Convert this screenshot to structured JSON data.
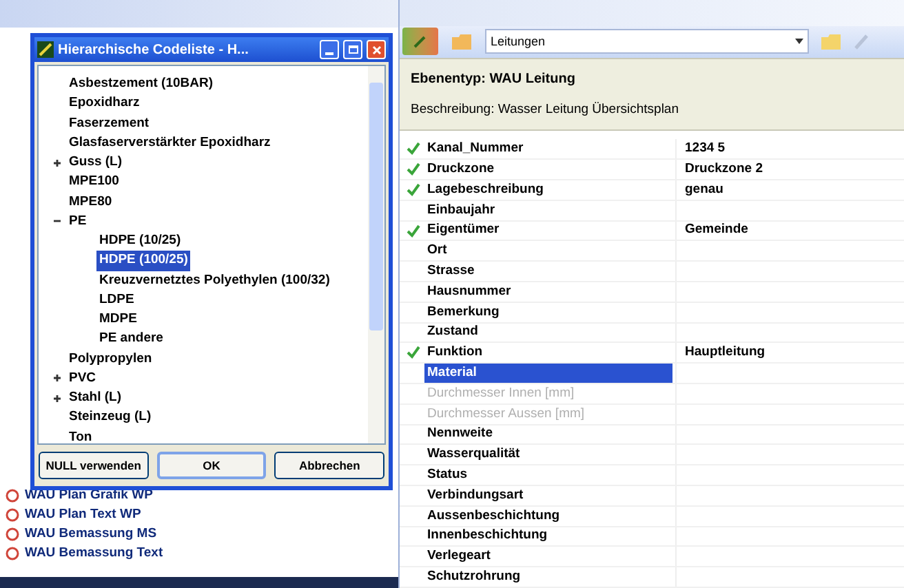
{
  "dialog": {
    "title": "Hierarchische Codeliste - H...",
    "tree": [
      {
        "label": "Asbestzement (10BAR)",
        "kind": "leaf",
        "selected": false
      },
      {
        "label": "Epoxidharz",
        "kind": "leaf",
        "selected": false
      },
      {
        "label": "Faserzement",
        "kind": "leaf",
        "selected": false
      },
      {
        "label": "Glasfaserverstärkter Epoxidharz",
        "kind": "leaf",
        "selected": false
      },
      {
        "label": "Guss (L)",
        "kind": "folder",
        "expanded": false,
        "selected": false
      },
      {
        "label": "MPE100",
        "kind": "leaf",
        "selected": false
      },
      {
        "label": "MPE80",
        "kind": "leaf",
        "selected": false
      },
      {
        "label": "PE",
        "kind": "folder",
        "expanded": true,
        "selected": false,
        "children": [
          {
            "label": "HDPE (10/25)",
            "kind": "leaf",
            "selected": false
          },
          {
            "label": "HDPE (100/25)",
            "kind": "leaf",
            "selected": true
          },
          {
            "label": "Kreuzvernetztes Polyethylen (100/32)",
            "kind": "leaf",
            "selected": false
          },
          {
            "label": "LDPE",
            "kind": "leaf",
            "selected": false
          },
          {
            "label": "MDPE",
            "kind": "leaf",
            "selected": false
          },
          {
            "label": "PE andere",
            "kind": "leaf",
            "selected": false
          }
        ]
      },
      {
        "label": "Polypropylen",
        "kind": "leaf",
        "selected": false
      },
      {
        "label": "PVC",
        "kind": "folder",
        "expanded": false,
        "selected": false
      },
      {
        "label": "Stahl (L)",
        "kind": "folder",
        "expanded": false,
        "selected": false
      },
      {
        "label": "Steinzeug (L)",
        "kind": "leaf",
        "selected": false
      },
      {
        "label": "Ton",
        "kind": "leaf",
        "selected": false
      }
    ],
    "buttons": [
      {
        "label": "NULL verwenden",
        "default": false
      },
      {
        "label": "OK",
        "default": true
      },
      {
        "label": "Abbrechen",
        "default": false
      }
    ]
  },
  "background_list": {
    "items": [
      "WAU Plan Grafik WP",
      "WAU Plan Text WP",
      "WAU Bemassung MS",
      "WAU Bemassung Text"
    ]
  },
  "toolbar": {
    "layer_dropdown": "Leitungen"
  },
  "layer_header": {
    "type": "Ebenentyp: WAU Leitung",
    "description": "Beschreibung: Wasser Leitung Übersichtsplan"
  },
  "properties": [
    {
      "name": "Kanal_Nummer",
      "value": "1234 5",
      "checked": true,
      "selected": false,
      "disabled": false
    },
    {
      "name": "Druckzone",
      "value": "Druckzone 2",
      "checked": true,
      "selected": false,
      "disabled": false
    },
    {
      "name": "Lagebeschreibung",
      "value": "genau",
      "checked": true,
      "selected": false,
      "disabled": false
    },
    {
      "name": "Einbaujahr",
      "checked": false,
      "selected": false,
      "disabled": false
    },
    {
      "name": "Eigentümer",
      "value": "Gemeinde",
      "checked": true,
      "selected": false,
      "disabled": false
    },
    {
      "name": "Ort",
      "checked": false,
      "selected": false,
      "disabled": false
    },
    {
      "name": "Strasse",
      "checked": false,
      "selected": false,
      "disabled": false
    },
    {
      "name": "Hausnummer",
      "checked": false,
      "selected": false,
      "disabled": false
    },
    {
      "name": "Bemerkung",
      "checked": false,
      "selected": false,
      "disabled": false
    },
    {
      "name": "Zustand",
      "checked": false,
      "selected": false,
      "disabled": false
    },
    {
      "name": "Funktion",
      "value": "Hauptleitung",
      "checked": true,
      "selected": false,
      "disabled": false
    },
    {
      "name": "Material",
      "checked": false,
      "selected": true,
      "disabled": false
    },
    {
      "name": "Durchmesser Innen [mm]",
      "checked": false,
      "selected": false,
      "disabled": true
    },
    {
      "name": "Durchmesser Aussen [mm]",
      "checked": false,
      "selected": false,
      "disabled": true
    },
    {
      "name": "Nennweite",
      "checked": false,
      "selected": false,
      "disabled": false
    },
    {
      "name": "Wasserqualität",
      "checked": false,
      "selected": false,
      "disabled": false
    },
    {
      "name": "Status",
      "checked": false,
      "selected": false,
      "disabled": false
    },
    {
      "name": "Verbindungsart",
      "checked": false,
      "selected": false,
      "disabled": false
    },
    {
      "name": "Aussenbeschichtung",
      "checked": false,
      "selected": false,
      "disabled": false
    },
    {
      "name": "Innenbeschichtung",
      "checked": false,
      "selected": false,
      "disabled": false
    },
    {
      "name": "Verlegeart",
      "checked": false,
      "selected": false,
      "disabled": false
    },
    {
      "name": "Schutzrohrung",
      "checked": false,
      "selected": false,
      "disabled": false
    }
  ]
}
